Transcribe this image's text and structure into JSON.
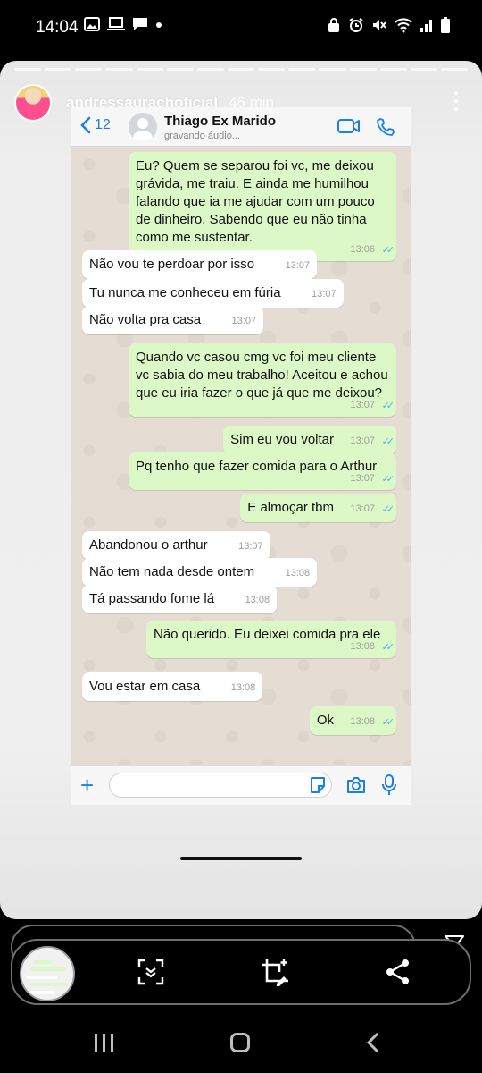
{
  "status_bar": {
    "time": "14:04",
    "left_icons": [
      "image-icon",
      "laptop-icon",
      "chat-icon",
      "dot-icon"
    ],
    "right_icons": [
      "lock-icon",
      "alarm-icon",
      "mute-icon",
      "wifi-icon",
      "signal-icon",
      "battery-icon"
    ]
  },
  "story": {
    "username": "andressaurachoficial",
    "posted": "46 min"
  },
  "chat": {
    "back_count": "12",
    "contact_name": "Thiago Ex Marido",
    "contact_status": "gravando áudio...",
    "accent": "#1a7ef2",
    "outgoing_color": "#dcf8c6",
    "incoming_color": "#ffffff",
    "messages": [
      {
        "dir": "out",
        "text": "Eu? Quem se separou foi vc, me deixou grávida, me traiu. E ainda me humilhou falando que ia me ajudar com um pouco de dinheiro. Sabendo que eu não tinha como me sustentar.",
        "time": "13:06"
      },
      {
        "dir": "in",
        "text": "Não vou te perdoar por isso",
        "time": "13:07"
      },
      {
        "dir": "in",
        "text": "Tu nunca me conheceu em fúria",
        "time": "13:07"
      },
      {
        "dir": "in",
        "text": "Não volta pra casa",
        "time": "13:07"
      },
      {
        "dir": "out",
        "text": "Quando vc casou cmg vc foi meu cliente vc sabia do meu trabalho! Aceitou e achou que eu iria fazer o que já que me deixou?",
        "time": "13:07"
      },
      {
        "dir": "out",
        "text": "Sim eu vou voltar",
        "time": "13:07"
      },
      {
        "dir": "out",
        "text": "Pq tenho que fazer comida para o Arthur",
        "time": "13:07"
      },
      {
        "dir": "out",
        "text": "E almoçar tbm",
        "time": "13:07"
      },
      {
        "dir": "in",
        "text": "Abandonou o arthur",
        "time": "13:07"
      },
      {
        "dir": "in",
        "text": "Não tem nada desde ontem",
        "time": "13:08"
      },
      {
        "dir": "in",
        "text": "Tá passando fome lá",
        "time": "13:08"
      },
      {
        "dir": "out",
        "text": "Não querido. Eu deixei comida pra ele",
        "time": "13:08"
      },
      {
        "dir": "in",
        "text": "Vou estar em casa",
        "time": "13:08"
      },
      {
        "dir": "out",
        "text": "Ok",
        "time": "13:08"
      }
    ]
  },
  "share_bar": {
    "icons": [
      "screenshot-icon",
      "crop-edit-icon",
      "share-icon"
    ]
  }
}
